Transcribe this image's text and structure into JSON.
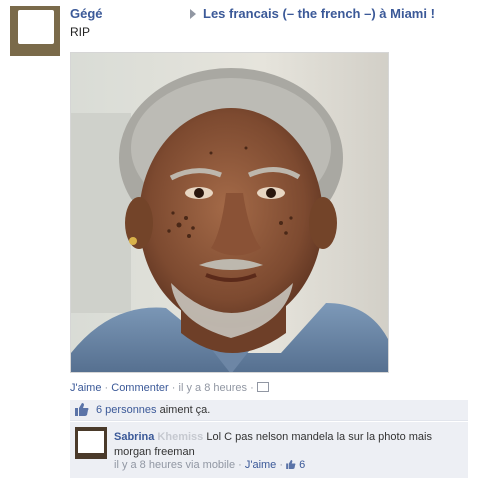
{
  "post": {
    "author": "Gégé",
    "group": "Les francais (– the french –) à Miami !",
    "text": "RIP"
  },
  "actions": {
    "like": "J'aime",
    "sep1": "·",
    "comment": "Commenter",
    "sep2": "·",
    "time": "il y a 8 heures",
    "sep3": "·"
  },
  "likes": {
    "count_link": "6 personnes",
    "suffix": "aiment ça."
  },
  "comment": {
    "name": "Sabrina",
    "name_hidden": "Khemiss",
    "text": "Lol C pas nelson mandela la sur la photo mais morgan freeman",
    "time": "il y a 8 heures via mobile",
    "sep1": "·",
    "like": "J'aime",
    "sep2": "·",
    "like_count": "6"
  },
  "colors": {
    "link": "#3b5998",
    "meta": "#9197a3",
    "box": "#edeff4"
  }
}
